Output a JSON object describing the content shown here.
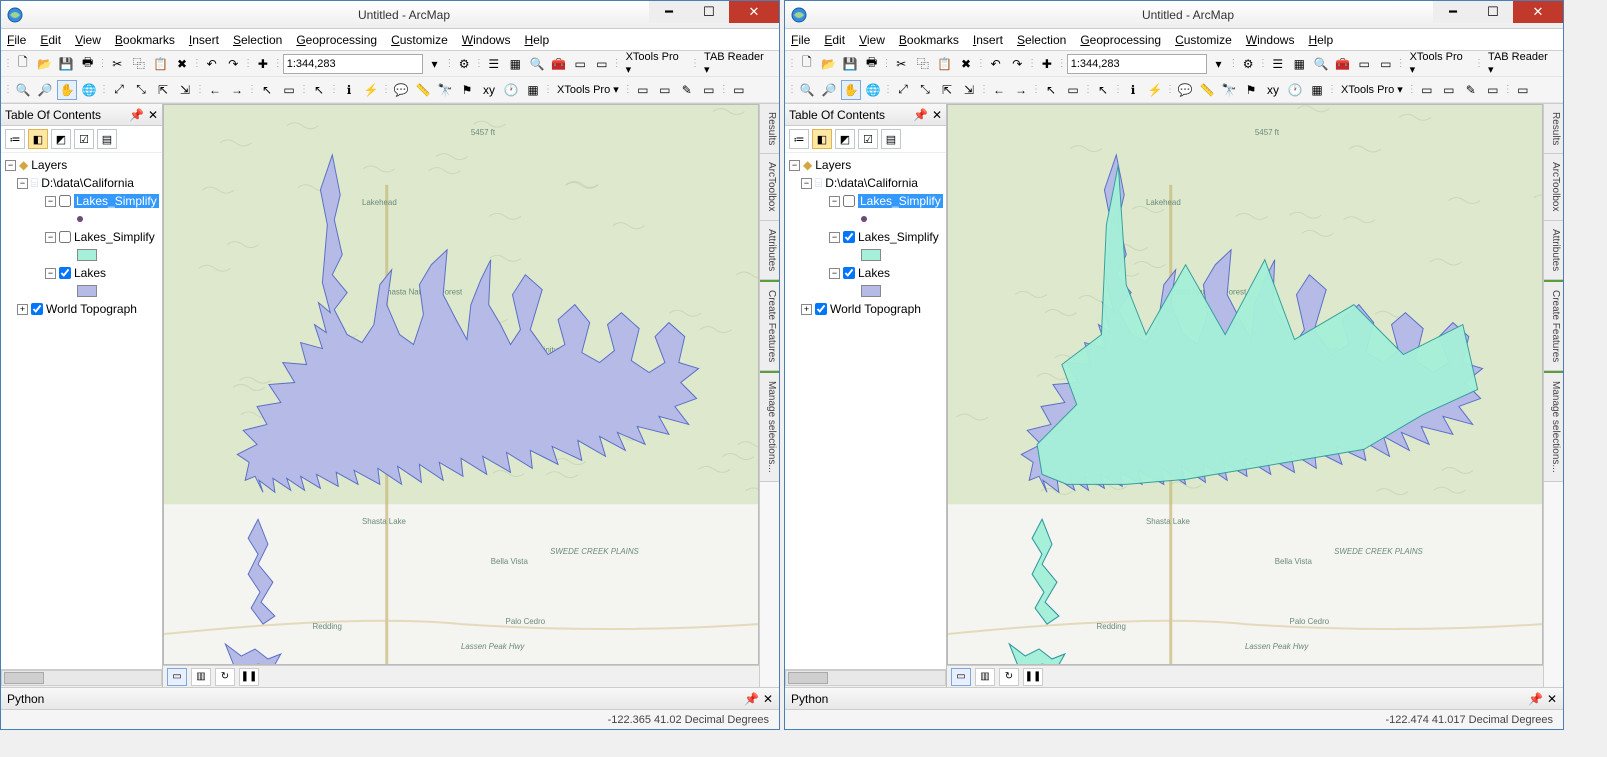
{
  "windows": [
    {
      "title": "Untitled - ArcMap",
      "menu": [
        "File",
        "Edit",
        "View",
        "Bookmarks",
        "Insert",
        "Selection",
        "Geoprocessing",
        "Customize",
        "Windows",
        "Help"
      ],
      "scale": "1:344,283",
      "toolgroups": [
        "XTools Pro ▾",
        "TAB Reader ▾",
        "XTools Pro ▾"
      ],
      "toc_title": "Table Of Contents",
      "layers_label": "Layers",
      "datasource": "D:\\data\\California",
      "layers": [
        {
          "name": "Lakes_Simplify",
          "checked": false,
          "selected": true,
          "type": "point"
        },
        {
          "name": "Lakes_Simplify",
          "checked": false,
          "selected": false,
          "type": "poly",
          "swatch": "#a6f0d9"
        },
        {
          "name": "Lakes",
          "checked": true,
          "selected": false,
          "type": "poly",
          "swatch": "#b5bbe6"
        },
        {
          "name": "World Topograph",
          "checked": true,
          "selected": false,
          "type": "basemap"
        }
      ],
      "overlay": {
        "show_simplified": false
      },
      "python_label": "Python",
      "status_coords": "-122.365  41.02 Decimal Degrees",
      "right_tabs": [
        "Results",
        "ArcToolbox",
        "Attributes",
        "Create Features",
        "Manage selections..."
      ],
      "map_labels": {
        "shasta_nf": "Shasta\nNational\nForest",
        "whiskey": "Whiskeytown\nShasta\nTrinity NRA",
        "shasta_lake": "Shasta Lake",
        "bella_vista": "Bella Vista",
        "swede": "SWEDE CREEK PLAINS",
        "redding": "Redding",
        "palo": "Palo Cedro",
        "lassen": "Lassen Peak Hwy",
        "elev": "5457 ft",
        "lakehead": "Lakehead"
      }
    },
    {
      "title": "Untitled - ArcMap",
      "menu": [
        "File",
        "Edit",
        "View",
        "Bookmarks",
        "Insert",
        "Selection",
        "Geoprocessing",
        "Customize",
        "Windows",
        "Help"
      ],
      "scale": "1:344,283",
      "toolgroups": [
        "XTools Pro ▾",
        "TAB Reader ▾",
        "XTools Pro ▾"
      ],
      "toc_title": "Table Of Contents",
      "layers_label": "Layers",
      "datasource": "D:\\data\\California",
      "layers": [
        {
          "name": "Lakes_Simplify",
          "checked": false,
          "selected": true,
          "type": "point"
        },
        {
          "name": "Lakes_Simplify",
          "checked": true,
          "selected": false,
          "type": "poly",
          "swatch": "#a6f0d9"
        },
        {
          "name": "Lakes",
          "checked": true,
          "selected": false,
          "type": "poly",
          "swatch": "#b5bbe6"
        },
        {
          "name": "World Topograph",
          "checked": true,
          "selected": false,
          "type": "basemap"
        }
      ],
      "overlay": {
        "show_simplified": true
      },
      "python_label": "Python",
      "status_coords": "-122.474  41.017 Decimal Degrees",
      "right_tabs": [
        "Results",
        "ArcToolbox",
        "Attributes",
        "Create Features",
        "Manage selections..."
      ],
      "map_labels": {
        "shasta_nf": "Shasta\nNational\nForest",
        "whiskey": "Whiskeytown\nShasta\nTrinity NRA",
        "shasta_lake": "Shasta Lake",
        "bella_vista": "Bella Vista",
        "swede": "SWEDE CREEK PLAINS",
        "redding": "Redding",
        "palo": "Palo Cedro",
        "lassen": "Lassen Peak Hwy",
        "elev": "5457 ft",
        "lakehead": "Lakehead"
      }
    }
  ],
  "colors": {
    "lake_fill": "#b5bbe6",
    "lake_stroke": "#5b6fc7",
    "simplified_fill": "#a6f0d9",
    "simplified_stroke": "#2e9c9c",
    "terrain_bg": "#dde8cc",
    "lowland": "#f4f4f0"
  }
}
